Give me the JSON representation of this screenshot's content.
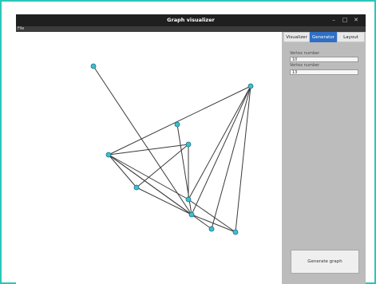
{
  "window": {
    "title": "Graph visualizer",
    "controls": {
      "minimize": "–",
      "maximize": "□",
      "close": "✕"
    }
  },
  "menu": {
    "file": "File"
  },
  "tabs": [
    {
      "label": "Visualizer",
      "active": false
    },
    {
      "label": "Generator",
      "active": true
    },
    {
      "label": "Layout",
      "active": false
    }
  ],
  "generator": {
    "vertex_label_1": "Vertex number",
    "vertex_value_1": "10",
    "vertex_label_2": "Vertex number",
    "vertex_value_2": "13",
    "generate_label": "Generate graph"
  },
  "colors": {
    "accent": "#2f6fc4",
    "node": "#3bc0d3",
    "frame": "#2ac7b8"
  }
}
